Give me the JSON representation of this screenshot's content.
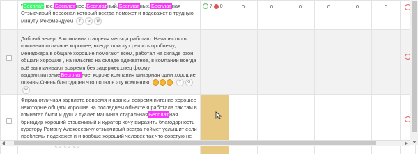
{
  "keyword": "Бесплат",
  "rows": [
    {
      "text_before_1": "\"",
      "text_mid_1": "ное,",
      "text_mid_2": "ное,",
      "text_mid_3": "ный,",
      "text_mid_4": "ных,",
      "text_mid_5": "ная",
      "text_rest": "Отзывчивый персонал который всегда поможет и подскажет в трудную минуту. Рекомендуем",
      "stats_green": "7",
      "stats_red": "0",
      "n1": "0",
      "n2": "0",
      "n3": "0",
      "n4": "0",
      "n5": "0",
      "n6": "0"
    },
    {
      "text_before": "Добрый вечер. В компании с апреля месяца работаю. Начальство в компании отличное хорошее, всегда помогут решить проблему, менеджера в общаге хорошие помогают всем, работал на складе озон общаги хорошие , начальство на складе адекватное, в компании всегда всё выплачивают вовремя без задержек,спец форму выдают,питание",
      "text_after": "ное, короче компания шикарная одни хорошие отзывы.Очень благодарен что попал в эту компанию."
    },
    {
      "text_before": "Фирма отличная зарплата вовремя и авансы вовремя питание хорошее некоторые общаги хорошие на последнем объекте я работала так там в комнатах были и душ и туалет машинка стиральная",
      "text_after": "ная бригадир хороший отзывчивый и куратор хочу выразить благодарность куратору Роману Алексеевичу отзывчивый всегда поймет услышит если проблемы подскажет и и вообще хороший человек так что советую не совевайтесь"
    }
  ],
  "badges": {
    "y": "Y",
    "g": "G",
    "w": "W"
  },
  "colors": {
    "highlight": "#ff33ff",
    "highlight_green": "#33ff66",
    "selected_cell": "#e8c983",
    "positive": "#5fbf5f",
    "negative": "#e05555"
  }
}
